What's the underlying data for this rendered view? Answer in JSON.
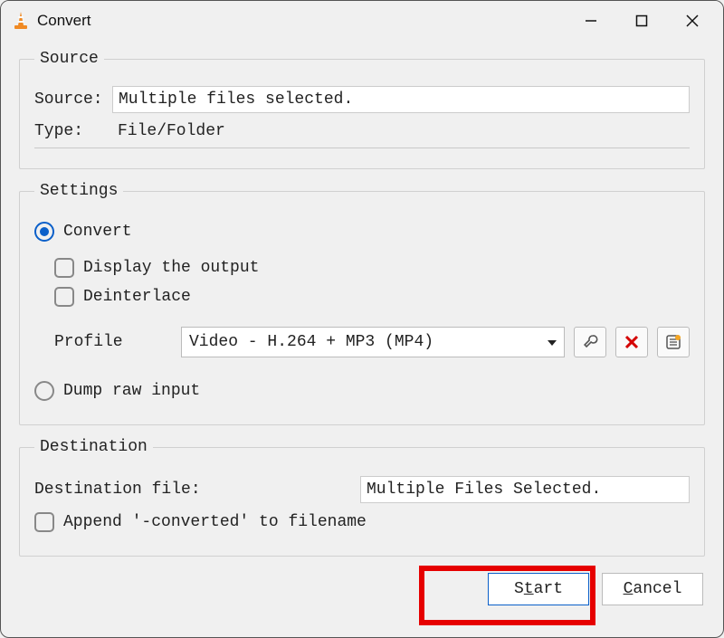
{
  "window": {
    "title": "Convert"
  },
  "source": {
    "legend": "Source",
    "sourceLabel": "Source:",
    "sourceValue": "Multiple files selected.",
    "typeLabel": "Type:",
    "typeValue": "File/Folder"
  },
  "settings": {
    "legend": "Settings",
    "convertLabel": "Convert",
    "displayOutputLabel": "Display the output",
    "deinterlaceLabel": "Deinterlace",
    "profileLabel": "Profile",
    "profileValue": "Video - H.264 + MP3 (MP4)",
    "dumpRawLabel": "Dump raw input"
  },
  "destination": {
    "legend": "Destination",
    "fileLabel": "Destination file:",
    "fileValue": "Multiple Files Selected.",
    "appendLabel": "Append '-converted' to filename"
  },
  "buttons": {
    "startPre": "S",
    "startAccel": "t",
    "startPost": "art",
    "cancelAccel": "C",
    "cancelPost": "ancel"
  },
  "icons": {
    "wrench": "wrench-icon",
    "delete": "delete-icon",
    "newprofile": "new-profile-icon"
  }
}
